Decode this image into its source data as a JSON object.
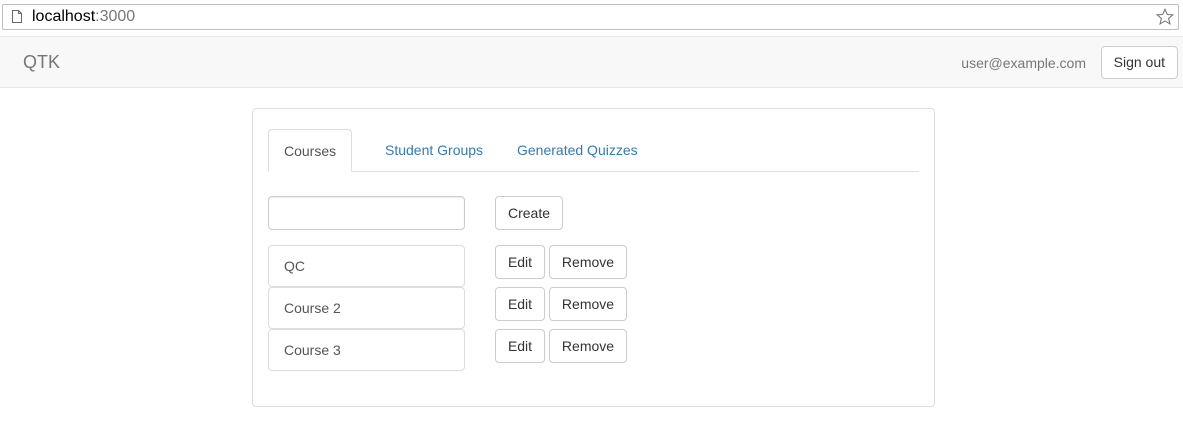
{
  "browser": {
    "url_host": "localhost",
    "url_port": ":3000"
  },
  "navbar": {
    "brand": "QTK",
    "user_email": "user@example.com",
    "sign_out_label": "Sign out"
  },
  "tabs": [
    {
      "label": "Courses",
      "active": true
    },
    {
      "label": "Student Groups",
      "active": false
    },
    {
      "label": "Generated Quizzes",
      "active": false
    }
  ],
  "create": {
    "input_value": "",
    "button_label": "Create"
  },
  "courses": [
    {
      "name": "QC",
      "edit_label": "Edit",
      "remove_label": "Remove"
    },
    {
      "name": "Course 2",
      "edit_label": "Edit",
      "remove_label": "Remove"
    },
    {
      "name": "Course 3",
      "edit_label": "Edit",
      "remove_label": "Remove"
    }
  ],
  "icons": {
    "page": "page-icon",
    "bookmark": "star-icon"
  },
  "colors": {
    "link": "#337ab7",
    "navbar_bg": "#f8f8f8",
    "muted_text": "#777777"
  }
}
